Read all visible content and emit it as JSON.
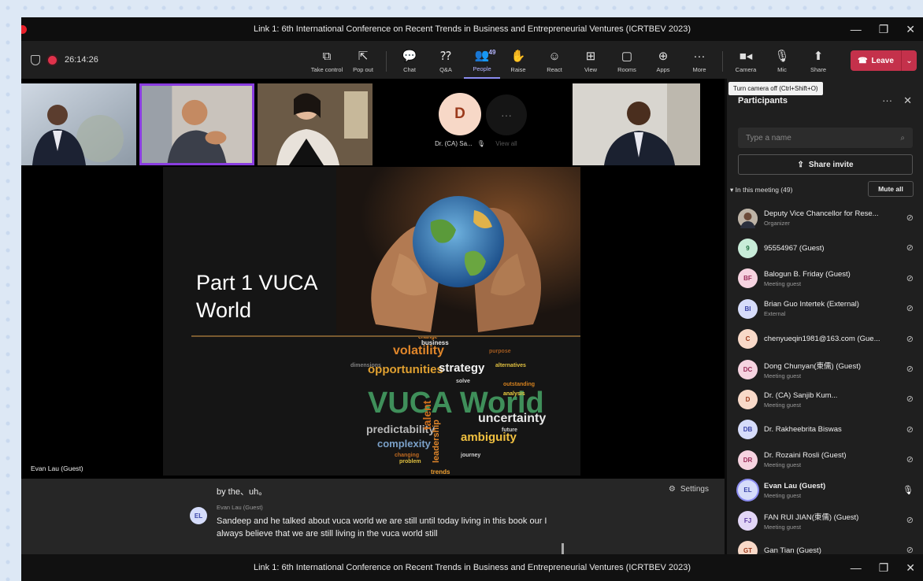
{
  "window": {
    "title": "Link 1: 6th International Conference on Recent Trends in Business and Entrepreneurial Ventures (ICRTBEV 2023)",
    "bottom_title": "Link 1: 6th International Conference on Recent Trends in Business and Entrepreneurial Ventures (ICRTBEV 2023)",
    "controls": {
      "minimize": "—",
      "restore": "❐",
      "close": "✕"
    }
  },
  "toolbar": {
    "timer": "26:14:26",
    "buttons": [
      {
        "label": "Take control",
        "icon": "take-control-icon",
        "glyph": "⧉"
      },
      {
        "label": "Pop out",
        "icon": "pop-out-icon",
        "glyph": "⇱"
      },
      {
        "label": "Chat",
        "icon": "chat-icon",
        "glyph": "💬"
      },
      {
        "label": "Q&A",
        "icon": "qa-icon",
        "glyph": "⁇"
      },
      {
        "label": "People",
        "icon": "people-icon",
        "glyph": "👥",
        "badge": "49",
        "active": true
      },
      {
        "label": "Raise",
        "icon": "raise-hand-icon",
        "glyph": "✋"
      },
      {
        "label": "React",
        "icon": "react-icon",
        "glyph": "☺"
      },
      {
        "label": "View",
        "icon": "view-icon",
        "glyph": "⊞"
      },
      {
        "label": "Rooms",
        "icon": "rooms-icon",
        "glyph": "▢"
      },
      {
        "label": "Apps",
        "icon": "apps-icon",
        "glyph": "⊕"
      },
      {
        "label": "More",
        "icon": "more-icon",
        "glyph": "···"
      },
      {
        "label": "Camera",
        "icon": "camera-icon",
        "glyph": "■◂"
      },
      {
        "label": "Mic",
        "icon": "mic-off-icon",
        "glyph": "🎙"
      },
      {
        "label": "Share",
        "icon": "share-icon",
        "glyph": "⬆"
      }
    ],
    "leave_label": "Leave"
  },
  "stage": {
    "avatar_tile": {
      "initial": "D",
      "name": "Dr. (CA) Sa..."
    },
    "view_all_label": "View all",
    "speaker_name": "Evan Lau (Guest)",
    "slide": {
      "title": "Part 1 VUCA World",
      "wordcloud": {
        "main": "VUCA World",
        "words": [
          "volatility",
          "opportunities",
          "strategy",
          "predictability",
          "uncertainty",
          "complexity",
          "ambiguity",
          "talent",
          "leadership",
          "business",
          "change",
          "purpose",
          "alternatives",
          "outstanding",
          "analysis",
          "solve",
          "problem",
          "trends",
          "journey",
          "dimensions",
          "changing",
          "future"
        ]
      }
    }
  },
  "captions": {
    "line1": "by the、uh。",
    "settings_label": "Settings",
    "speaker": "Evan Lau (Guest)",
    "speaker_initials": "EL",
    "text": "Sandeep and he talked about vuca world we are still until today living in this book our I always believe that we are still living in the vuca world still"
  },
  "participants": {
    "tooltip": "Turn camera off (Ctrl+Shift+O)",
    "title": "Participants",
    "search_placeholder": "Type a name",
    "share_invite": "Share invite",
    "section_label": "In this meeting (49)",
    "mute_all": "Mute all",
    "list": [
      {
        "initials": "",
        "photo": true,
        "name": "Deputy Vice Chancellor for Rese...",
        "role": "Organizer",
        "bg": "#c9c2b8",
        "fg": "#333"
      },
      {
        "initials": "9",
        "name": "95554967 (Guest)",
        "role": "",
        "bg": "#c8ecd8",
        "fg": "#1f6b3e"
      },
      {
        "initials": "BF",
        "name": "Balogun B. Friday (Guest)",
        "role": "Meeting guest",
        "bg": "#f6d3e0",
        "fg": "#9a2b58"
      },
      {
        "initials": "BI",
        "name": "Brian Guo Intertek (External)",
        "role": "External",
        "bg": "#d6dcfa",
        "fg": "#3a44a8"
      },
      {
        "initials": "C",
        "name": "chenyueqin1981@163.com (Gue...",
        "role": "",
        "bg": "#f8d9c8",
        "fg": "#9b3a1c"
      },
      {
        "initials": "DC",
        "name": "Dong Chunyan(東儒) (Guest)",
        "role": "Meeting guest",
        "bg": "#f6d3e0",
        "fg": "#9a2b58"
      },
      {
        "initials": "D",
        "name": "Dr. (CA) Sanjib Kum...",
        "role": "Meeting guest",
        "bg": "#f8d9c8",
        "fg": "#9b3a1c"
      },
      {
        "initials": "DB",
        "name": "Dr. Rakheebrita Biswas",
        "role": "",
        "bg": "#d6dcfa",
        "fg": "#3a44a8"
      },
      {
        "initials": "DR",
        "name": "Dr. Rozaini Rosli (Guest)",
        "role": "Meeting guest",
        "bg": "#f6d3e0",
        "fg": "#9a2b58"
      },
      {
        "initials": "EL",
        "name": "Evan Lau (Guest)",
        "role": "Meeting guest",
        "bg": "#d6dcfa",
        "fg": "#3a44a8",
        "speaking": true
      },
      {
        "initials": "FJ",
        "name": "FAN RUI JIAN(東儒) (Guest)",
        "role": "Meeting guest",
        "bg": "#e2d6f6",
        "fg": "#5b3aa0"
      },
      {
        "initials": "GT",
        "name": "Gan Tian (Guest)",
        "role": "",
        "bg": "#f8d9c8",
        "fg": "#9b3a1c"
      }
    ]
  }
}
